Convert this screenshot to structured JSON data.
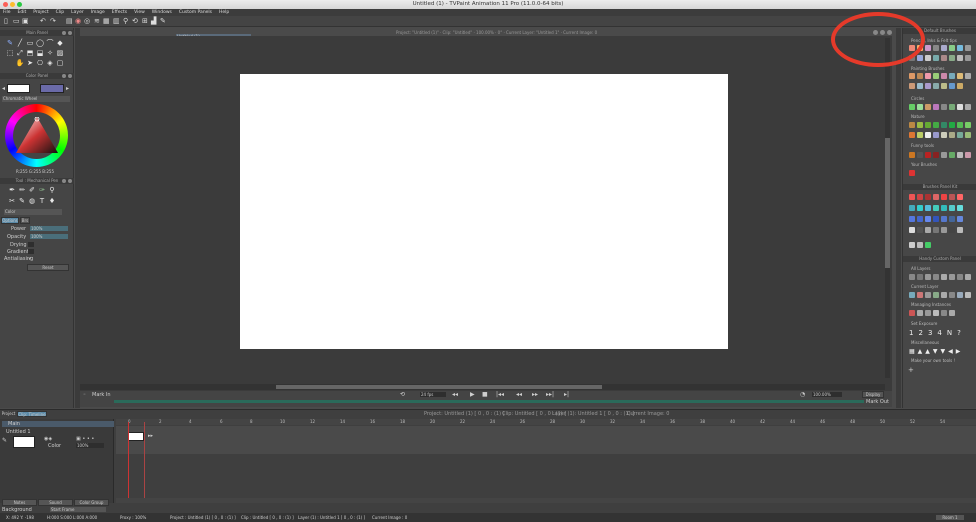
{
  "window": {
    "title": "Untitled (1) - TVPaint Animation 11 Pro (11.0.0-64 bits)"
  },
  "menu": [
    "File",
    "Edit",
    "Project",
    "Clip",
    "Layer",
    "Image",
    "Effects",
    "View",
    "Windows",
    "Custom Panels",
    "Help"
  ],
  "toolbar": {
    "document_name": "Untitled (1)"
  },
  "info_bar": "Project: \"Untitled (1)\" · Clip: \"Untitled\" · 100.00% · 0° · Current Layer: \"Untitled 1\" · Current Image: 0",
  "left": {
    "main_panel": "Main Panel",
    "color_panel": "Color Panel",
    "color_mode": "Chromatic Wheel",
    "rgb": "R:255 G:255 B:255",
    "tool_panel": "Tool : Mechanical Pen",
    "color_label": "Color",
    "options_tab": "Options",
    "options_tab2": "Brs",
    "power_label": "Power",
    "power_value": "100%",
    "opacity_label": "Opacity",
    "opacity_value": "100%",
    "drying_label": "Drying",
    "gradient_label": "Gradient",
    "aliasing_label": "Antialiasing",
    "reset_label": "Reset"
  },
  "canvas": {
    "mark_in": "Mark In",
    "mark_out": "Mark Out",
    "fps": "24 fps",
    "zoom": "100.00%",
    "display": "Display"
  },
  "right": {
    "panel_title": "Default Brushes",
    "sections": [
      "Pencils, Inks & Felt tips",
      "Painting Brushes",
      "Circles",
      "Nature",
      "Funny tools",
      "Your Brushes"
    ],
    "panel2_title": "Brushes Panel Kit",
    "panel3_title": "Handy Custom Panel",
    "sections3": [
      "All Layers",
      "Current Layer",
      "Managing Instances",
      "Set Exposure",
      "Miscellaneous",
      "Make your own tools !"
    ],
    "exposures": [
      "1",
      "2",
      "3",
      "4",
      "N"
    ]
  },
  "timeline": {
    "project_tab": "Project",
    "clip_tab": "Clip: Timeline",
    "header_info": [
      "Project: Untitled (1) [ 0 , 0 : (1) ]",
      "Clip: Untitled [ 0 , 0 : (1) ]",
      "Layer (1): Untitled 1 [ 0 , 0 : (1) ]",
      "Current Image: 0"
    ],
    "layer_group": "Main",
    "layer_name": "Untitled 1",
    "layer_mode": "Color",
    "layer_opacity": "100%",
    "frames": [
      "0",
      "2",
      "4",
      "6",
      "8",
      "10",
      "12",
      "14",
      "16",
      "18",
      "20",
      "22",
      "24",
      "26",
      "28",
      "30",
      "32",
      "34",
      "36",
      "38",
      "40",
      "42",
      "44",
      "46",
      "48",
      "50",
      "52",
      "54"
    ],
    "bottom_buttons": [
      "Notes",
      "Sound",
      "Color Group"
    ],
    "background": "Background",
    "start_frame": "Start Frame"
  },
  "status": {
    "coords": "X: 492  Y: -198",
    "color": "H:000 S:000 L:000 A:000",
    "proxy": "Proxy : 100%",
    "project": "Project : Untitled (1) [ 0 , 0 : (1) ]",
    "clip": "Clip : Untitled [ 0 , 0 : (1) ]",
    "layer": "Layer (1) : Untitled 1 [ 0 , 0 : (1) ]",
    "image": "Current Image : 0",
    "room": "Room 1"
  },
  "colors": {
    "accent": "#6a6aa8",
    "highlight": "#e53a2a",
    "bg": "#4a4a4a"
  }
}
